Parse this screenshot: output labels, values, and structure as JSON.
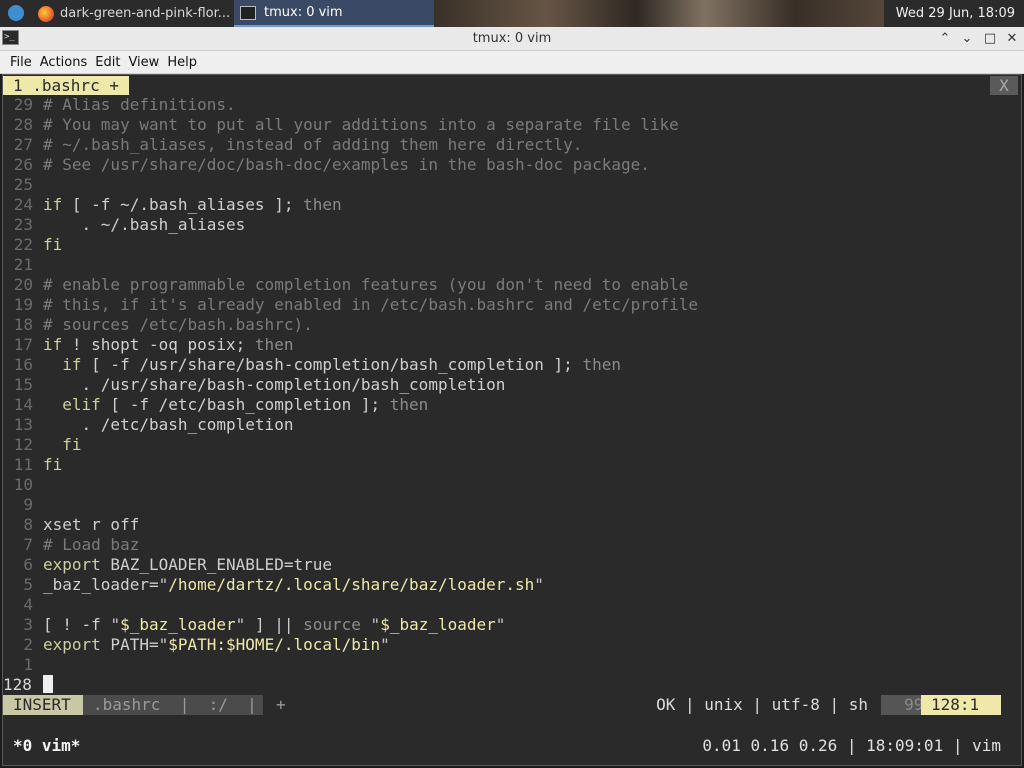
{
  "panel": {
    "tasks": [
      {
        "label": "dark-green-and-pink-flor..."
      },
      {
        "label": "tmux: 0 vim"
      }
    ],
    "clock": "Wed 29 Jun, 18:09"
  },
  "window": {
    "title": "tmux: 0 vim",
    "buttons": {
      "minimize": "⌃",
      "restore": "⌄",
      "maximize": "□",
      "close": "✕"
    }
  },
  "menu": [
    "File",
    "Actions",
    "Edit",
    "View",
    "Help"
  ],
  "vim": {
    "tab_label": "1 .bashrc +",
    "tab_close": "X",
    "lines": [
      {
        "n": "29",
        "t": "# Alias definitions."
      },
      {
        "n": "28",
        "t": "# You may want to put all your additions into a separate file like"
      },
      {
        "n": "27",
        "t": "# ~/.bash_aliases, instead of adding them here directly."
      },
      {
        "n": "26",
        "t": "# See /usr/share/doc/bash-doc/examples in the bash-doc package."
      },
      {
        "n": "25",
        "t": ""
      },
      {
        "n": "24",
        "t": "if [ -f ~/.bash_aliases ]; then"
      },
      {
        "n": "23",
        "t": "    . ~/.bash_aliases"
      },
      {
        "n": "22",
        "t": "fi"
      },
      {
        "n": "21",
        "t": ""
      },
      {
        "n": "20",
        "t": "# enable programmable completion features (you don't need to enable"
      },
      {
        "n": "19",
        "t": "# this, if it's already enabled in /etc/bash.bashrc and /etc/profile"
      },
      {
        "n": "18",
        "t": "# sources /etc/bash.bashrc)."
      },
      {
        "n": "17",
        "t": "if ! shopt -oq posix; then"
      },
      {
        "n": "16",
        "t": "  if [ -f /usr/share/bash-completion/bash_completion ]; then"
      },
      {
        "n": "15",
        "t": "    . /usr/share/bash-completion/bash_completion"
      },
      {
        "n": "14",
        "t": "  elif [ -f /etc/bash_completion ]; then"
      },
      {
        "n": "13",
        "t": "    . /etc/bash_completion"
      },
      {
        "n": "12",
        "t": "  fi"
      },
      {
        "n": "11",
        "t": "fi"
      },
      {
        "n": "10",
        "t": ""
      },
      {
        "n": "9",
        "t": ""
      },
      {
        "n": "8",
        "t": "xset r off"
      },
      {
        "n": "7",
        "t": "# Load baz"
      },
      {
        "n": "6",
        "t": "export BAZ_LOADER_ENABLED=true"
      },
      {
        "n": "5",
        "t": "_baz_loader=\"/home/dartz/.local/share/baz/loader.sh\""
      },
      {
        "n": "4",
        "t": ""
      },
      {
        "n": "3",
        "t": "[ ! -f \"$_baz_loader\" ] || source \"$_baz_loader\""
      },
      {
        "n": "2",
        "t": "export PATH=\"$PATH:$HOME/.local/bin\""
      },
      {
        "n": "1",
        "t": ""
      },
      {
        "n": "128",
        "t": ""
      }
    ],
    "status": {
      "mode": "INSERT",
      "file": ".bashrc  |  :/  |  +",
      "info": "OK | unix | utf-8 | sh",
      "percent": "99%",
      "position": "128:1"
    }
  },
  "tmux": {
    "window": "*0 vim*",
    "right": "0.01 0.16 0.26 | 18:09:01 | vim"
  }
}
